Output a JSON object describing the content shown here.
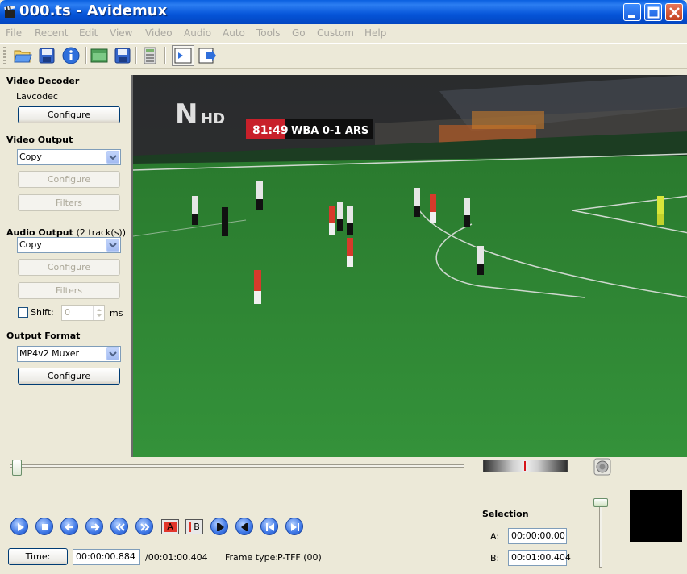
{
  "window": {
    "title": "000.ts - Avidemux"
  },
  "menu": [
    "File",
    "Recent",
    "Edit",
    "View",
    "Video",
    "Audio",
    "Auto",
    "Tools",
    "Go",
    "Custom",
    "Help"
  ],
  "sidebar": {
    "video_decoder": {
      "title": "Video Decoder",
      "codec": "Lavcodec",
      "configure": "Configure"
    },
    "video_output": {
      "title": "Video Output",
      "value": "Copy",
      "configure": "Configure",
      "filters": "Filters"
    },
    "audio_output": {
      "title": "Audio Output",
      "tracks": "(2 track(s))",
      "value": "Copy",
      "configure": "Configure",
      "filters": "Filters",
      "shift_label": "Shift:",
      "shift_value": "0",
      "shift_unit": "ms"
    },
    "output_format": {
      "title": "Output Format",
      "value": "MP4v2 Muxer",
      "configure": "Configure"
    }
  },
  "video": {
    "channel_logo": "N",
    "channel_suffix": "HD",
    "score_clock": "81:49",
    "score_text": "WBA 0-1 ARS"
  },
  "playback": {
    "marker_a": "A",
    "marker_b": "B"
  },
  "status": {
    "time_button": "Time:",
    "current_time": "00:00:00.884",
    "total_time": "/00:01:00.404",
    "frame_type_label": "Frame type:",
    "frame_type_value": "P-TFF (00)"
  },
  "selection": {
    "title": "Selection",
    "a_label": "A:",
    "a_value": "00:00:00.00",
    "b_label": "B:",
    "b_value": "00:01:00.404"
  },
  "colors": {
    "title_bar": "#0554d8",
    "pitch": "#2f8a32",
    "score_red": "#c8202a"
  }
}
